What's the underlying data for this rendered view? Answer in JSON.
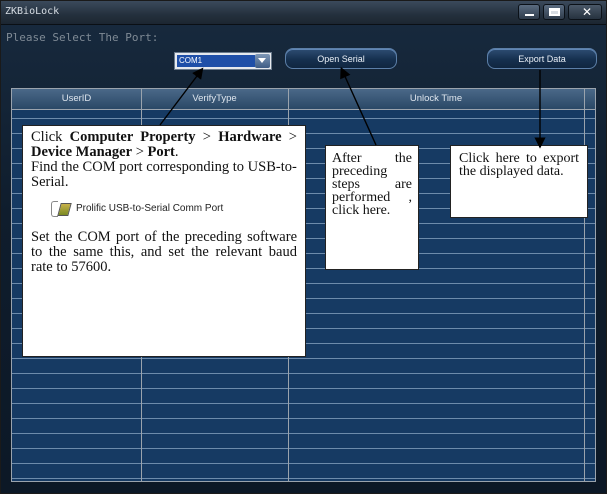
{
  "window": {
    "title": "ZKBioLock"
  },
  "port": {
    "label": "Please Select The Port:",
    "selected": "COM1"
  },
  "buttons": {
    "open_serial": "Open Serial",
    "export_data": "Export Data"
  },
  "table": {
    "columns": [
      "UserID",
      "VerifyType",
      "Unlock Time"
    ]
  },
  "callouts": {
    "port_instructions": {
      "click": "Click ",
      "path1": "Computer Property",
      "sep1": " > ",
      "path2": "Hardware",
      "sep2": " > ",
      "path3": "Device Manager",
      "sep3": " > ",
      "path4": "Port",
      "end": ".",
      "line2": "Find the COM port corresponding to USB-to-Serial.",
      "device_name": "Prolific USB-to-Serial Comm Port",
      "line3": "Set the COM port of the preceding software to the same this, and set the relevant baud rate to 57600."
    },
    "open_serial_note": "After the preceding steps are performed , click here.",
    "export_note": "Click here to export the displayed data."
  },
  "colors": {
    "window_bg": "#0e1f30",
    "table_bg": "#163a63",
    "selection": "#1f4fa8"
  }
}
